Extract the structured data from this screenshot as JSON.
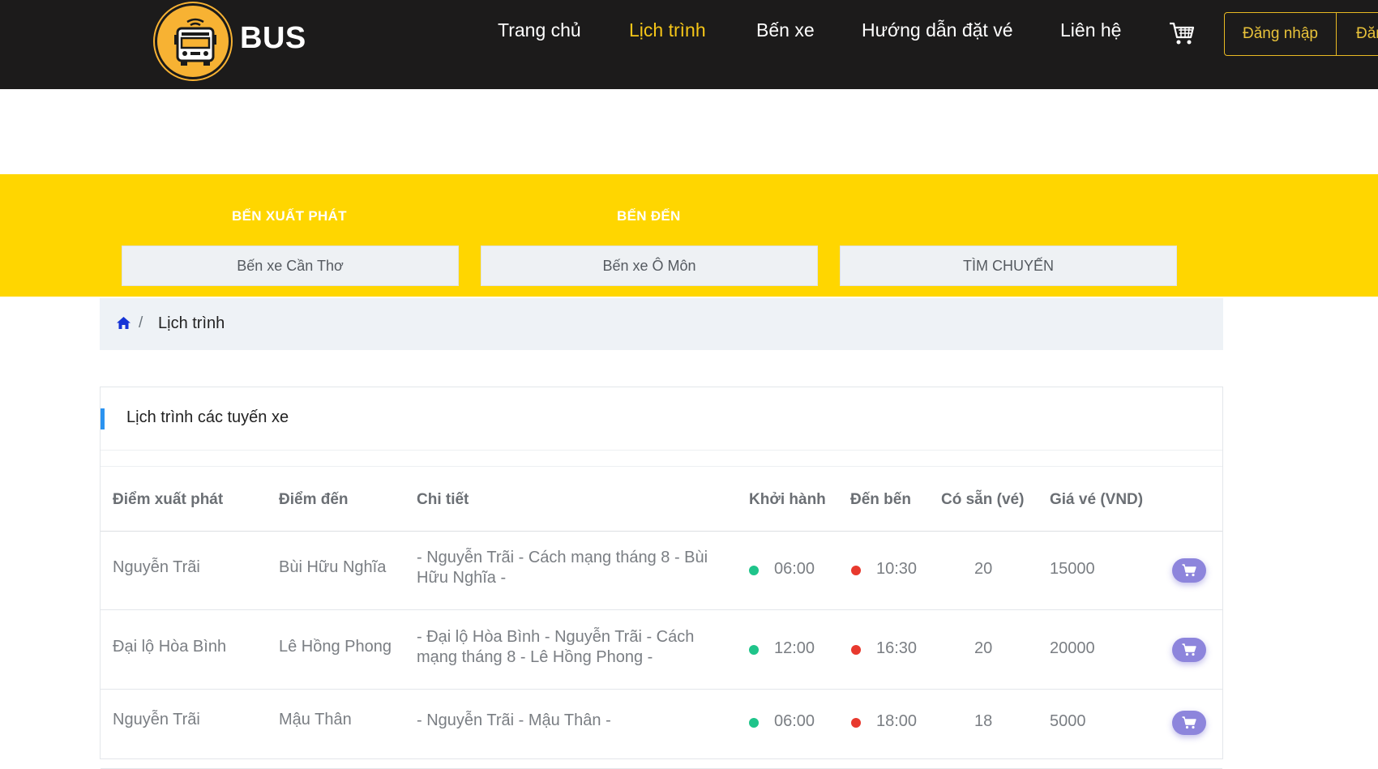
{
  "header": {
    "brand": "BUS",
    "nav": [
      {
        "label": "Trang chủ",
        "active": false
      },
      {
        "label": "Lịch trình",
        "active": true
      },
      {
        "label": "Bến xe",
        "active": false
      },
      {
        "label": "Hướng dẫn đặt vé",
        "active": false
      },
      {
        "label": "Liên hệ",
        "active": false
      }
    ],
    "cart_icon": "cart-icon",
    "login_label": "Đăng nhập",
    "register_label": "Đăn",
    "accent_color": "#f5c518",
    "background_color": "#1c1b1b"
  },
  "search": {
    "origin_label": "BẾN XUẤT PHÁT",
    "destination_label": "BẾN ĐẾN",
    "origin_value": "Bến xe Cần Thơ",
    "destination_value": "Bến xe Ô Môn",
    "search_button": "TÌM CHUYẾN",
    "band_color": "#ffd600"
  },
  "breadcrumb": {
    "home_icon": "home-icon",
    "separator": "/",
    "current": "Lịch trình"
  },
  "schedule": {
    "title": "Lịch trình các tuyến xe",
    "columns": [
      "Điểm xuất phát",
      "Điểm đến",
      "Chi tiết",
      "Khởi hành",
      "Đến bến",
      "Có sẵn (vé)",
      "Giá vé (VND)"
    ],
    "rows": [
      {
        "from": "Nguyễn Trãi",
        "to": "Bùi Hữu Nghĩa",
        "detail": "- Nguyễn Trãi - Cách mạng tháng 8 - Bùi Hữu Nghĩa -",
        "depart": "06:00",
        "arrive": "10:30",
        "available": "20",
        "price": "15000"
      },
      {
        "from": "Đại lộ Hòa Bình",
        "to": "Lê Hồng Phong",
        "detail": "- Đại lộ Hòa Bình - Nguyễn Trãi - Cách mạng tháng 8 - Lê Hồng Phong -",
        "depart": "12:00",
        "arrive": "16:30",
        "available": "20",
        "price": "20000"
      },
      {
        "from": "Nguyễn Trãi",
        "to": "Mậu Thân",
        "detail": "- Nguyễn Trãi - Mậu Thân -",
        "depart": "06:00",
        "arrive": "18:00",
        "available": "18",
        "price": "5000"
      }
    ],
    "depart_dot_color": "#1fc48a",
    "arrive_dot_color": "#e8392e",
    "cart_button_color": "#8d85dc"
  }
}
